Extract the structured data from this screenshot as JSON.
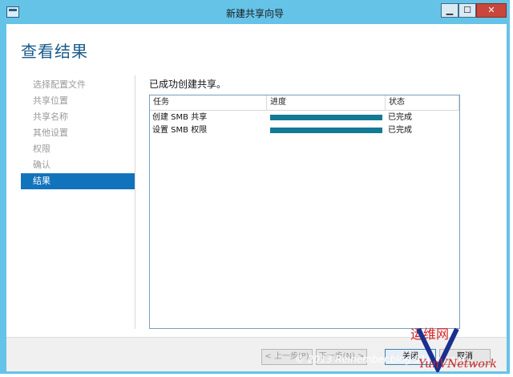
{
  "window": {
    "title": "新建共享向导"
  },
  "window_controls": {
    "minimize": "▁",
    "maximize": "☐",
    "close": "✕"
  },
  "page": {
    "title": "查看结果"
  },
  "nav": {
    "items": [
      {
        "label": "选择配置文件",
        "state": "disabled"
      },
      {
        "label": "共享位置",
        "state": "disabled"
      },
      {
        "label": "共享名称",
        "state": "disabled"
      },
      {
        "label": "其他设置",
        "state": "disabled"
      },
      {
        "label": "权限",
        "state": "disabled"
      },
      {
        "label": "确认",
        "state": "disabled"
      },
      {
        "label": "结果",
        "state": "active"
      }
    ]
  },
  "result": {
    "heading": "已成功创建共享。",
    "columns": {
      "task": "任务",
      "progress": "进度",
      "status": "状态"
    },
    "rows": [
      {
        "task": "创建 SMB 共享",
        "progress": 1.0,
        "status": "已完成"
      },
      {
        "task": "设置 SMB 权限",
        "progress": 1.0,
        "status": "已完成"
      }
    ]
  },
  "footer": {
    "prev": "< 上一步(P)",
    "next": "下一步(N) >",
    "close": "关闭",
    "cancel": "取消",
    "watermark": "© 2013 Reinember.blog.51cto.com"
  },
  "logo": {
    "cn": "运维网",
    "en": "YunVNetwork"
  },
  "colors": {
    "titlebar": "#65c3e8",
    "nav_active": "#1273bd",
    "progress": "#127a94",
    "page_title": "#1a5a8a"
  }
}
